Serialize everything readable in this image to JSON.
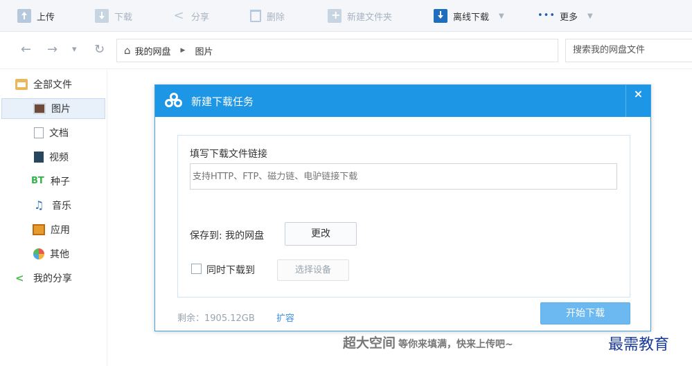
{
  "toolbar": {
    "upload": "上传",
    "download": "下载",
    "share": "分享",
    "delete": "删除",
    "new_folder": "新建文件夹",
    "offline_download": "离线下载",
    "more_dots": "•••",
    "more": "更多",
    "caret": "▼"
  },
  "address": {
    "back": "←",
    "forward": "→",
    "history": "▾",
    "refresh": "↻",
    "home_icon": "⌂",
    "crumbs": [
      "我的网盘",
      "图片"
    ],
    "crumb_sep": "▶",
    "search_placeholder": "搜索我的网盘文件"
  },
  "sidebar": {
    "items": [
      {
        "label": "全部文件",
        "icon": "folder-all-icon"
      },
      {
        "label": "图片",
        "icon": "picture-icon"
      },
      {
        "label": "文档",
        "icon": "document-icon"
      },
      {
        "label": "视频",
        "icon": "video-icon"
      },
      {
        "label": "种子",
        "icon": "bt-icon",
        "glyph": "BT"
      },
      {
        "label": "音乐",
        "icon": "music-icon",
        "glyph": "♫"
      },
      {
        "label": "应用",
        "icon": "app-icon"
      },
      {
        "label": "其他",
        "icon": "other-icon"
      },
      {
        "label": "我的分享",
        "icon": "share-icon",
        "glyph": "<"
      }
    ],
    "selected_index": 1
  },
  "dialog": {
    "title": "新建下载任务",
    "close": "×",
    "link_label": "填写下载文件链接",
    "link_placeholder": "支持HTTP、FTP、磁力链、电驴链接下载",
    "link_value": "",
    "save_to": "保存到: 我的网盘",
    "change_button": "更改",
    "sync_checkbox_label": "同时下载到",
    "sync_checked": false,
    "select_device_button": "选择设备",
    "remaining": "剩余：1905.12GB",
    "expand": "扩容",
    "start_button": "开始下载"
  },
  "footer": {
    "slogan_big": "超大空间",
    "slogan_small": "等你来填满，快来上传吧~"
  },
  "watermark": "最需教育",
  "colors": {
    "accent": "#1e96e6",
    "start_button": "#6bb9f0",
    "link": "#3b8ee0"
  }
}
